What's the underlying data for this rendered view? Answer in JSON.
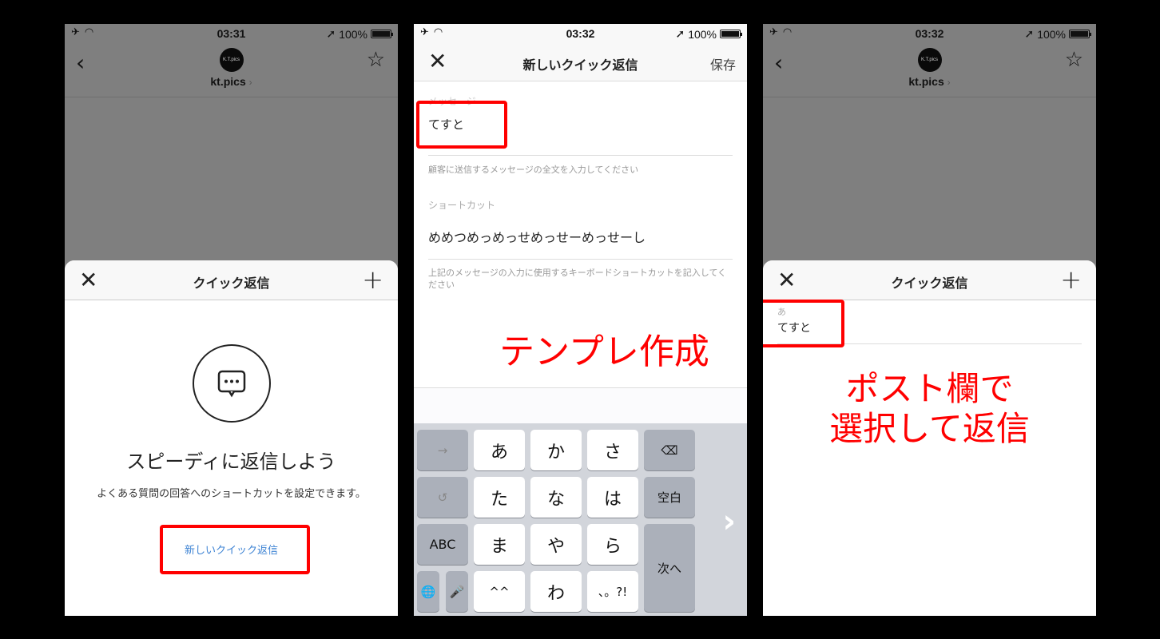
{
  "panels": [
    {
      "status": {
        "time": "03:31",
        "battery": "100%"
      },
      "profile": {
        "avatar_text": "K.T.pics",
        "username": "kt.pics",
        "chevron": "›"
      },
      "sheet": {
        "title": "クイック返信",
        "close": "✕",
        "add": "+",
        "headline": "スピーディに返信しよう",
        "description": "よくある質問の回答へのショートカットを設定できます。",
        "new_button": "新しいクイック返信"
      }
    },
    {
      "status": {
        "time": "03:32",
        "battery": "100%"
      },
      "nav": {
        "title": "新しいクイック返信",
        "close": "✕",
        "save": "保存"
      },
      "form": {
        "message_label": "メッセージ",
        "message_value": "てすと",
        "message_help": "顧客に送信するメッセージの全文を入力してください",
        "shortcut_label": "ショートカット",
        "shortcut_value": "めめつめっめっせめっせーめっせーし",
        "shortcut_help": "上記のメッセージの入力に使用するキーボードショートカットを記入してください"
      },
      "annotation": "テンプレ作成",
      "keyboard": {
        "rows": [
          [
            "→",
            "あ",
            "か",
            "さ",
            "⌫"
          ],
          [
            "↺",
            "た",
            "な",
            "は",
            "空白"
          ],
          [
            "ABC",
            "ま",
            "や",
            "ら",
            "次へ"
          ],
          [
            "🌐",
            "🎤",
            "^^",
            "わ",
            "、。?!"
          ]
        ],
        "next_chevron": "›"
      }
    },
    {
      "status": {
        "time": "03:32",
        "battery": "100%"
      },
      "profile": {
        "avatar_text": "K.T.pics",
        "username": "kt.pics",
        "chevron": "›"
      },
      "sheet": {
        "title": "クイック返信",
        "close": "✕",
        "add": "+",
        "items": [
          {
            "shortcut": "あ",
            "message": "てすと"
          }
        ]
      },
      "annotation_line1": "ポスト欄で",
      "annotation_line2": "選択して返信"
    }
  ],
  "colors": {
    "highlight": "#ff0000",
    "link": "#3f84d4",
    "dim_overlay": "#7f7f7f"
  }
}
